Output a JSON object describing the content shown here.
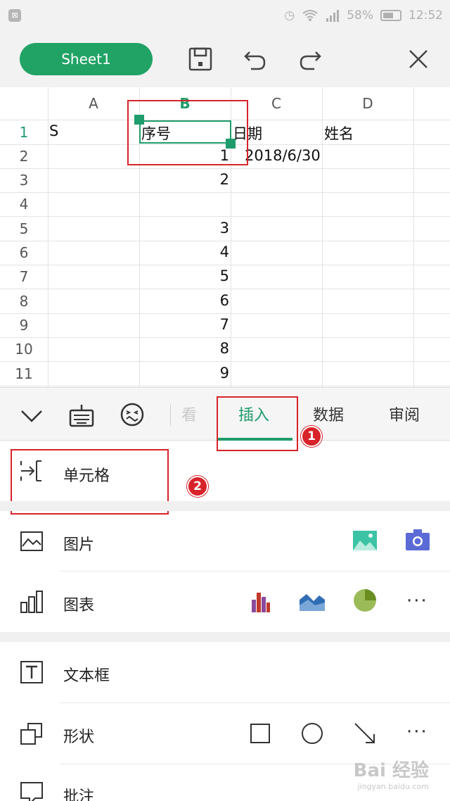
{
  "status_bar": {
    "battery": "58%",
    "time": "12:52"
  },
  "toolbar": {
    "sheet_name": "Sheet1"
  },
  "grid": {
    "columns": [
      "A",
      "B",
      "C",
      "D"
    ],
    "rows": [
      "1",
      "2",
      "3",
      "4",
      "5",
      "6",
      "7",
      "8",
      "9",
      "10",
      "11"
    ],
    "cells": {
      "A1": "S",
      "B1": "序号",
      "C1": "日期",
      "D1": "姓名",
      "B2": "1",
      "C2": "2018/6/30",
      "B3": "2",
      "B5": "3",
      "B6": "4",
      "B7": "5",
      "B8": "6",
      "B9": "7",
      "B10": "8",
      "B11": "9"
    }
  },
  "tabs": {
    "view": "看",
    "insert": "插入",
    "data": "数据",
    "review": "审阅"
  },
  "menu": {
    "cell": "单元格",
    "picture": "图片",
    "chart": "图表",
    "textbox": "文本框",
    "shape": "形状",
    "comment": "批注"
  },
  "badges": {
    "one": "1",
    "two": "2"
  },
  "watermark": {
    "brand": "Bai 经验",
    "url": "jingyan.baidu.com"
  },
  "colors": {
    "accent": "#21a366",
    "highlight": "#d8232a"
  }
}
